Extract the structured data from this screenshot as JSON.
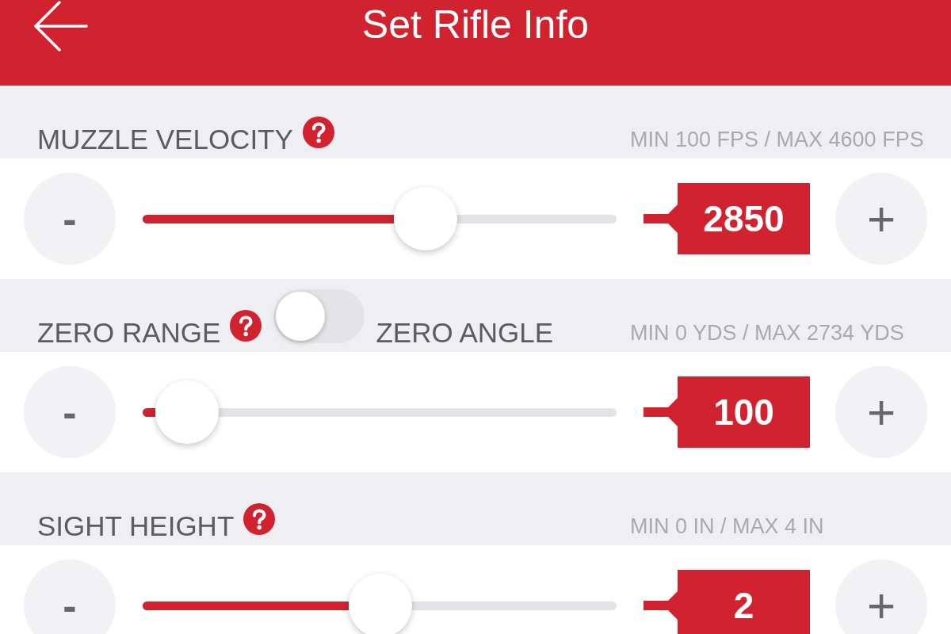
{
  "header": {
    "title": "Set Rifle Info"
  },
  "sections": [
    {
      "kind": "plain",
      "label": "MUZZLE VELOCITY",
      "range": "MIN 100 FPS / MAX 4600 FPS",
      "decrement": "-",
      "level": 0.53,
      "value": "2850",
      "increment": "+"
    },
    {
      "kind": "switch",
      "label": "ZERO RANGE",
      "switch": {
        "on": false,
        "alt_label": "ZERO ANGLE"
      },
      "range": "MIN 0 YDS / MAX 2734 YDS",
      "decrement": "-",
      "level": 0.027,
      "value": "100",
      "increment": "+"
    },
    {
      "kind": "plain",
      "label": "SIGHT HEIGHT",
      "range": "MIN 0 IN / MAX 4 IN",
      "decrement": "-",
      "level": 0.435,
      "value": "2",
      "increment": "+"
    }
  ]
}
